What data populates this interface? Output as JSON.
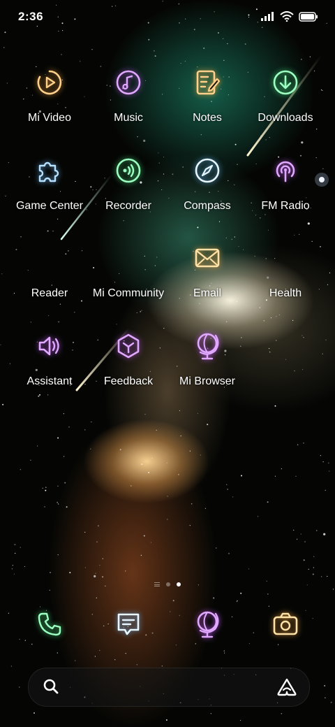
{
  "status_bar": {
    "time": "2:36",
    "icons": [
      "signal-icon",
      "wifi-icon",
      "battery-icon"
    ]
  },
  "colors": {
    "orange_glow": "#ffb347",
    "purple_glow": "#c77dff",
    "green_glow": "#5dff9a",
    "blue_glow": "#8fd3ff"
  },
  "apps": [
    {
      "label": "Mi Video",
      "icon": "play-icon",
      "glow": "orange"
    },
    {
      "label": "Music",
      "icon": "music-icon",
      "glow": "purple"
    },
    {
      "label": "Notes",
      "icon": "notes-icon",
      "glow": "orange"
    },
    {
      "label": "Downloads",
      "icon": "download-icon",
      "glow": "green"
    },
    {
      "label": "Game Center",
      "icon": "puzzle-icon",
      "glow": "blue"
    },
    {
      "label": "Recorder",
      "icon": "recorder-icon",
      "glow": "green"
    },
    {
      "label": "Compass",
      "icon": "compass-icon",
      "glow": "blue"
    },
    {
      "label": "FM Radio",
      "icon": "radio-icon",
      "glow": "purple"
    },
    {
      "label": "Reader",
      "icon": "",
      "glow": ""
    },
    {
      "label": "Mi Community",
      "icon": "",
      "glow": ""
    },
    {
      "label": "Email",
      "icon": "mail-icon",
      "glow": "orange"
    },
    {
      "label": "Health",
      "icon": "",
      "glow": ""
    },
    {
      "label": "Assistant",
      "icon": "speaker-icon",
      "glow": "purple"
    },
    {
      "label": "Feedback",
      "icon": "feedback-icon",
      "glow": "purple"
    },
    {
      "label": "Mi Browser",
      "icon": "globe-icon",
      "glow": "purple"
    }
  ],
  "page_indicator": {
    "pages": 2,
    "current": 2
  },
  "dock": [
    {
      "icon": "phone-icon",
      "glow": "green"
    },
    {
      "icon": "messages-icon",
      "glow": "blue"
    },
    {
      "icon": "browser-icon",
      "glow": "purple"
    },
    {
      "icon": "camera-icon",
      "glow": "orange"
    }
  ],
  "search_bar": {
    "left_icon": "search-icon",
    "right_icon": "assistant-icon"
  }
}
